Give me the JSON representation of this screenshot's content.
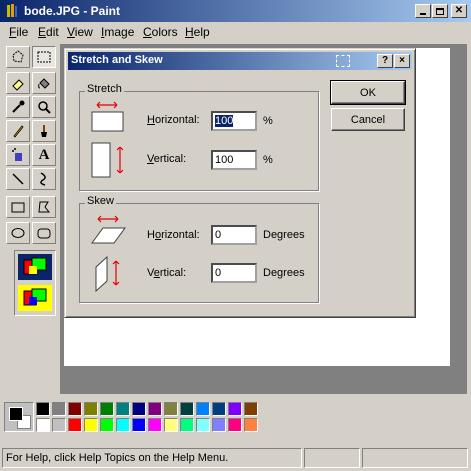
{
  "window": {
    "title": "bode.JPG - Paint"
  },
  "menu": [
    {
      "pre": "",
      "u": "F",
      "post": "ile"
    },
    {
      "pre": "",
      "u": "E",
      "post": "dit"
    },
    {
      "pre": "",
      "u": "V",
      "post": "iew"
    },
    {
      "pre": "",
      "u": "I",
      "post": "mage"
    },
    {
      "pre": "",
      "u": "C",
      "post": "olors"
    },
    {
      "pre": "",
      "u": "H",
      "post": "elp"
    }
  ],
  "dialog": {
    "title": "Stretch and Skew",
    "help_btn": "?",
    "close_btn": "×",
    "stretch_group": "Stretch",
    "skew_group": "Skew",
    "stretch_horizontal_label": {
      "u": "H",
      "rest": "orizontal:"
    },
    "stretch_vertical_label": {
      "u": "V",
      "rest": "ertical:"
    },
    "stretch_horizontal_value": "100",
    "stretch_vertical_value": "100",
    "percent_unit": "%",
    "skew_horizontal_label": {
      "pre": "H",
      "u": "o",
      "rest": "rizontal:"
    },
    "skew_vertical_label": {
      "pre": "V",
      "u": "e",
      "rest": "rtical:"
    },
    "skew_horizontal_value": "0",
    "skew_vertical_value": "0",
    "degrees_unit": "Degrees",
    "ok_label": "OK",
    "cancel_label": "Cancel"
  },
  "palette": {
    "foreground": "#000000",
    "background": "#ffffff",
    "row1": [
      "#000000",
      "#808080",
      "#800000",
      "#808000",
      "#008000",
      "#008080",
      "#000080",
      "#800080",
      "#808040",
      "#004040",
      "#0080ff",
      "#004080",
      "#8000ff",
      "#804000"
    ],
    "row2": [
      "#ffffff",
      "#c0c0c0",
      "#ff0000",
      "#ffff00",
      "#00ff00",
      "#00ffff",
      "#0000ff",
      "#ff00ff",
      "#ffff80",
      "#00ff80",
      "#80ffff",
      "#8080ff",
      "#ff0080",
      "#ff8040"
    ]
  },
  "status": {
    "text": "For Help, click Help Topics on the Help Menu."
  },
  "icons": {
    "toolbox": [
      "free-select-icon",
      "rect-select-icon",
      "eraser-icon",
      "fill-icon",
      "color-picker-icon",
      "magnifier-icon",
      "pencil-icon",
      "brush-icon",
      "airbrush-icon",
      "text-icon",
      "line-icon",
      "curve-icon",
      "rectangle-icon",
      "polygon-icon",
      "ellipse-icon",
      "rounded-rect-icon"
    ]
  }
}
